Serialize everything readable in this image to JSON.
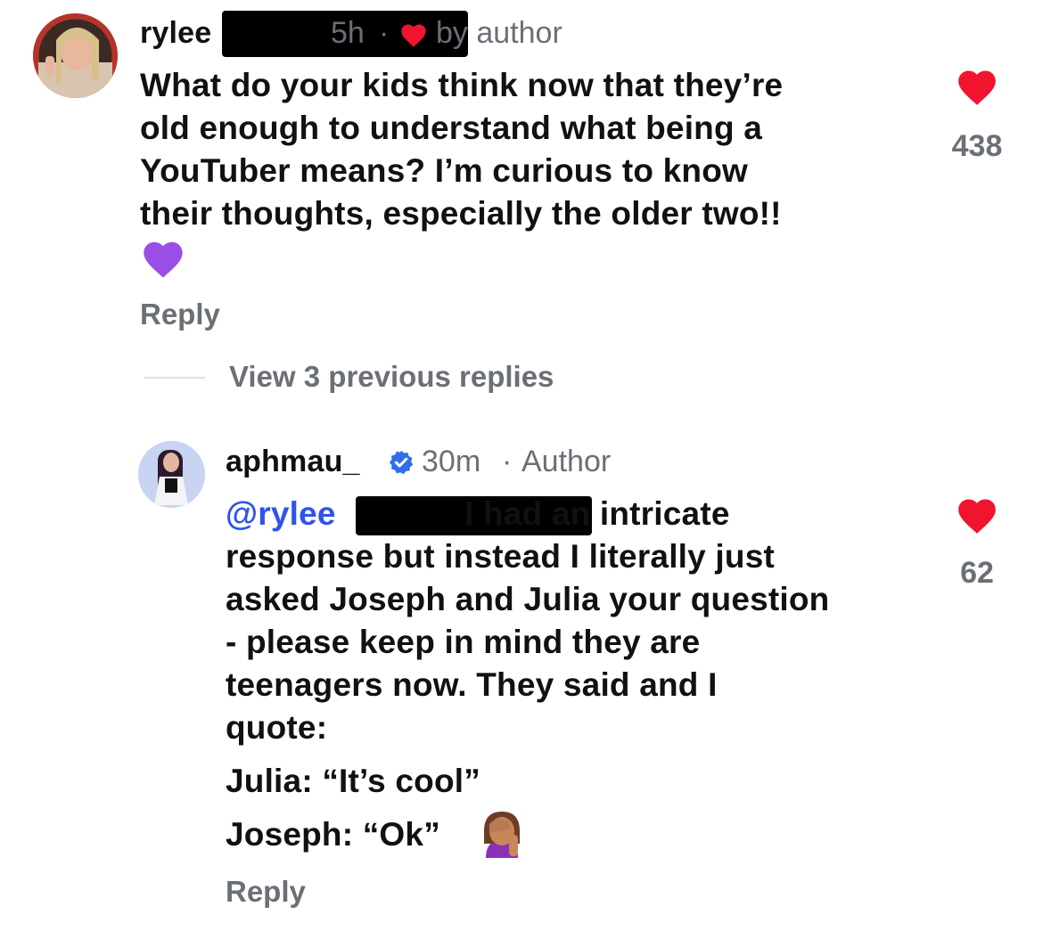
{
  "comments": [
    {
      "username": "rylee",
      "time": "5h",
      "separator": "·",
      "liked_by_author": "by author",
      "lines": [
        "What do your kids think now that they’re",
        "old enough to understand what being a",
        "YouTuber means? I’m curious to know",
        "their thoughts, especially the older two!!"
      ],
      "emoji": "💜",
      "likes": "438",
      "reply_label": "Reply"
    }
  ],
  "thread": {
    "view_replies": "View 3 previous replies"
  },
  "reply": {
    "username": "aphmau_",
    "time": "30m",
    "separator": "·",
    "role": "Author",
    "mention": "@rylee",
    "first_line_rest": "I had an intricate",
    "lines": [
      "response but instead I literally just",
      "asked Joseph and Julia your question",
      "- please keep in mind they are",
      "teenagers now. They said and I",
      "quote:"
    ],
    "julia_line": "Julia: “It’s cool”",
    "joseph_line": "Joseph: “Ok”",
    "emoji": "🤦🏽‍♀️",
    "likes": "62",
    "reply_label": "Reply"
  },
  "colors": {
    "heart": "#f0142e",
    "meta": "#6b6f76",
    "mention": "#2f54eb",
    "verified": "#2f6fe8"
  }
}
